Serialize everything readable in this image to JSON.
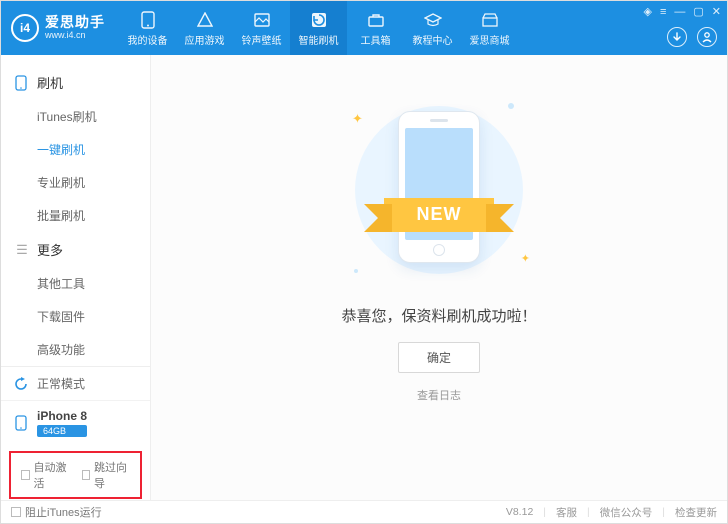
{
  "header": {
    "logo_glyph": "i4",
    "app_name": "爱思助手",
    "site_url": "www.i4.cn",
    "nav": [
      {
        "label": "我的设备"
      },
      {
        "label": "应用游戏"
      },
      {
        "label": "铃声壁纸"
      },
      {
        "label": "智能刷机"
      },
      {
        "label": "工具箱"
      },
      {
        "label": "教程中心"
      },
      {
        "label": "爱思商城"
      }
    ]
  },
  "sidebar": {
    "section_flash": {
      "title": "刷机",
      "items": [
        "iTunes刷机",
        "一键刷机",
        "专业刷机",
        "批量刷机"
      ]
    },
    "section_more": {
      "title": "更多",
      "items": [
        "其他工具",
        "下载固件",
        "高级功能"
      ]
    },
    "status_mode": "正常模式",
    "device_name": "iPhone 8",
    "device_storage": "64GB",
    "opt_auto_activate": "自动激活",
    "opt_skip_wizard": "跳过向导"
  },
  "main": {
    "ribbon_text": "NEW",
    "success_msg": "恭喜您，保资料刷机成功啦！",
    "ok_label": "确定",
    "log_link": "查看日志"
  },
  "footer": {
    "block_itunes": "阻止iTunes运行",
    "version": "V8.12",
    "links": [
      "客服",
      "微信公众号",
      "检查更新"
    ]
  }
}
